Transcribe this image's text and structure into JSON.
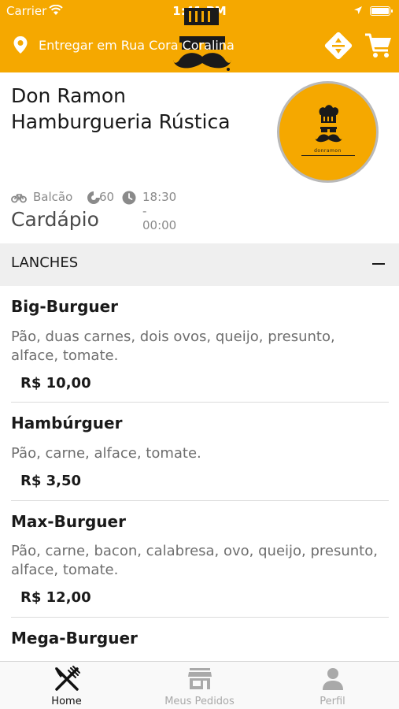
{
  "status_bar": {
    "carrier": "Carrier",
    "time": "1:41 PM"
  },
  "header": {
    "delivery_address": "Entregar em Rua Cora Coralina"
  },
  "restaurant": {
    "name": "Don Ramon Hamburgueria Rústica",
    "logo_brand": "donramon",
    "service_type": "Balcão",
    "prep_time": "60",
    "hours": "18:30 - 00:00"
  },
  "menu": {
    "title": "Cardápio",
    "category": "LANCHES",
    "items": [
      {
        "name": "Big-Burguer",
        "description": "Pão, duas carnes, dois ovos, queijo, presunto, alface, tomate.",
        "price": "R$ 10,00"
      },
      {
        "name": "Hambúrguer",
        "description": "Pão, carne, alface, tomate.",
        "price": "R$ 3,50"
      },
      {
        "name": "Max-Burguer",
        "description": "Pão, carne, bacon, calabresa, ovo, queijo, presunto, alface, tomate.",
        "price": "R$ 12,00"
      },
      {
        "name": "Mega-Burguer"
      }
    ]
  },
  "tabs": [
    {
      "label": "Home",
      "icon": "fork-knife-icon",
      "active": true
    },
    {
      "label": "Meus Pedidos",
      "icon": "store-icon",
      "active": false
    },
    {
      "label": "Perfil",
      "icon": "user-icon",
      "active": false
    }
  ],
  "colors": {
    "brand": "#f5a800",
    "text": "#1a1a1a",
    "muted": "#8a8a8a",
    "tab_inactive": "#a9a9a9"
  }
}
